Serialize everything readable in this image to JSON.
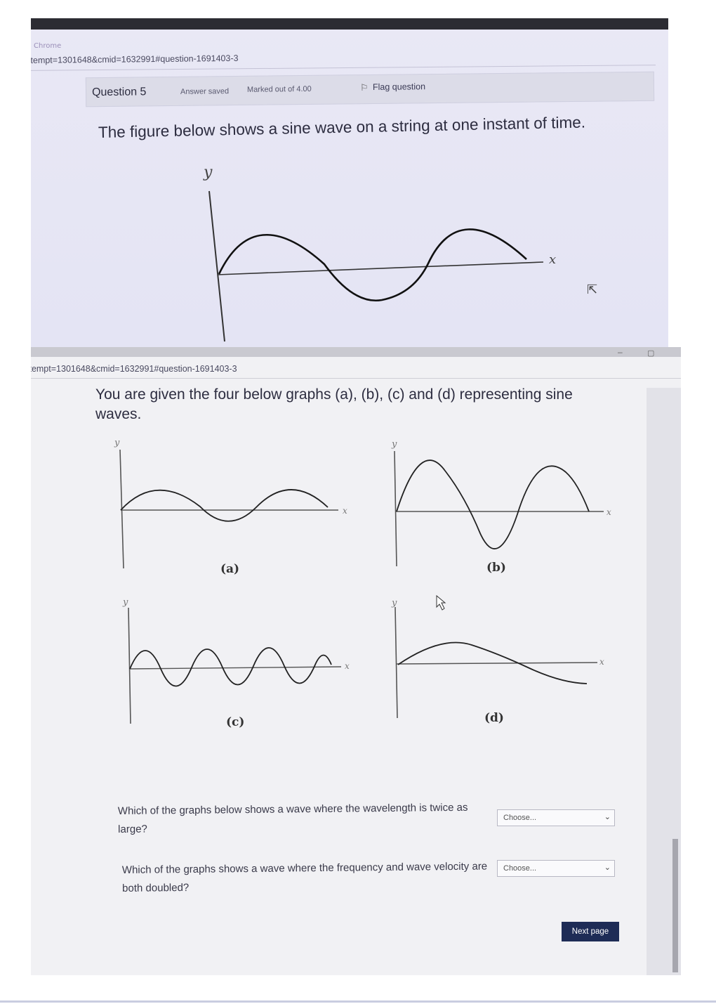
{
  "photo1": {
    "browser_label": "Chrome",
    "url": "ttempt=1301648&cmid=1632991#question-1691403-3",
    "question_bar": {
      "number": "Question 5",
      "status": "Answer saved",
      "marked": "Marked out of 4.00",
      "flag_label": "Flag question",
      "flag_icon": "flag-icon"
    },
    "question_text": "The figure below shows a sine wave on a string at one instant of time.",
    "figure": {
      "y_label": "y",
      "x_label": "x"
    }
  },
  "photo2": {
    "url": "ttempt=1301648&cmid=1632991#question-1691403-3",
    "question_text": "You are given the four below graphs (a), (b), (c) and (d) representing sine waves.",
    "graphs": [
      {
        "label": "(a)",
        "y_label": "y",
        "x_label": "x"
      },
      {
        "label": "(b)",
        "y_label": "y",
        "x_label": "x"
      },
      {
        "label": "(c)",
        "y_label": "y",
        "x_label": "x"
      },
      {
        "label": "(d)",
        "y_label": "y",
        "x_label": "x"
      }
    ],
    "questions": [
      {
        "text": "Which of the graphs below shows a wave where the wavelength is twice as large?",
        "select_value": "Choose..."
      },
      {
        "text": "Which of the graphs shows a wave where the frequency and wave velocity are both doubled?",
        "select_value": "Choose..."
      }
    ],
    "next_button": "Next page",
    "window_controls": {
      "minimize": "–",
      "maximize": "▢"
    }
  },
  "icons": {
    "cursor": "cursor-icon",
    "chevron": "chevron-down-icon"
  },
  "colors": {
    "button_bg": "#1e2c56",
    "screen_top": "#e6e6f5",
    "screen_bottom": "#f1f1f4"
  }
}
